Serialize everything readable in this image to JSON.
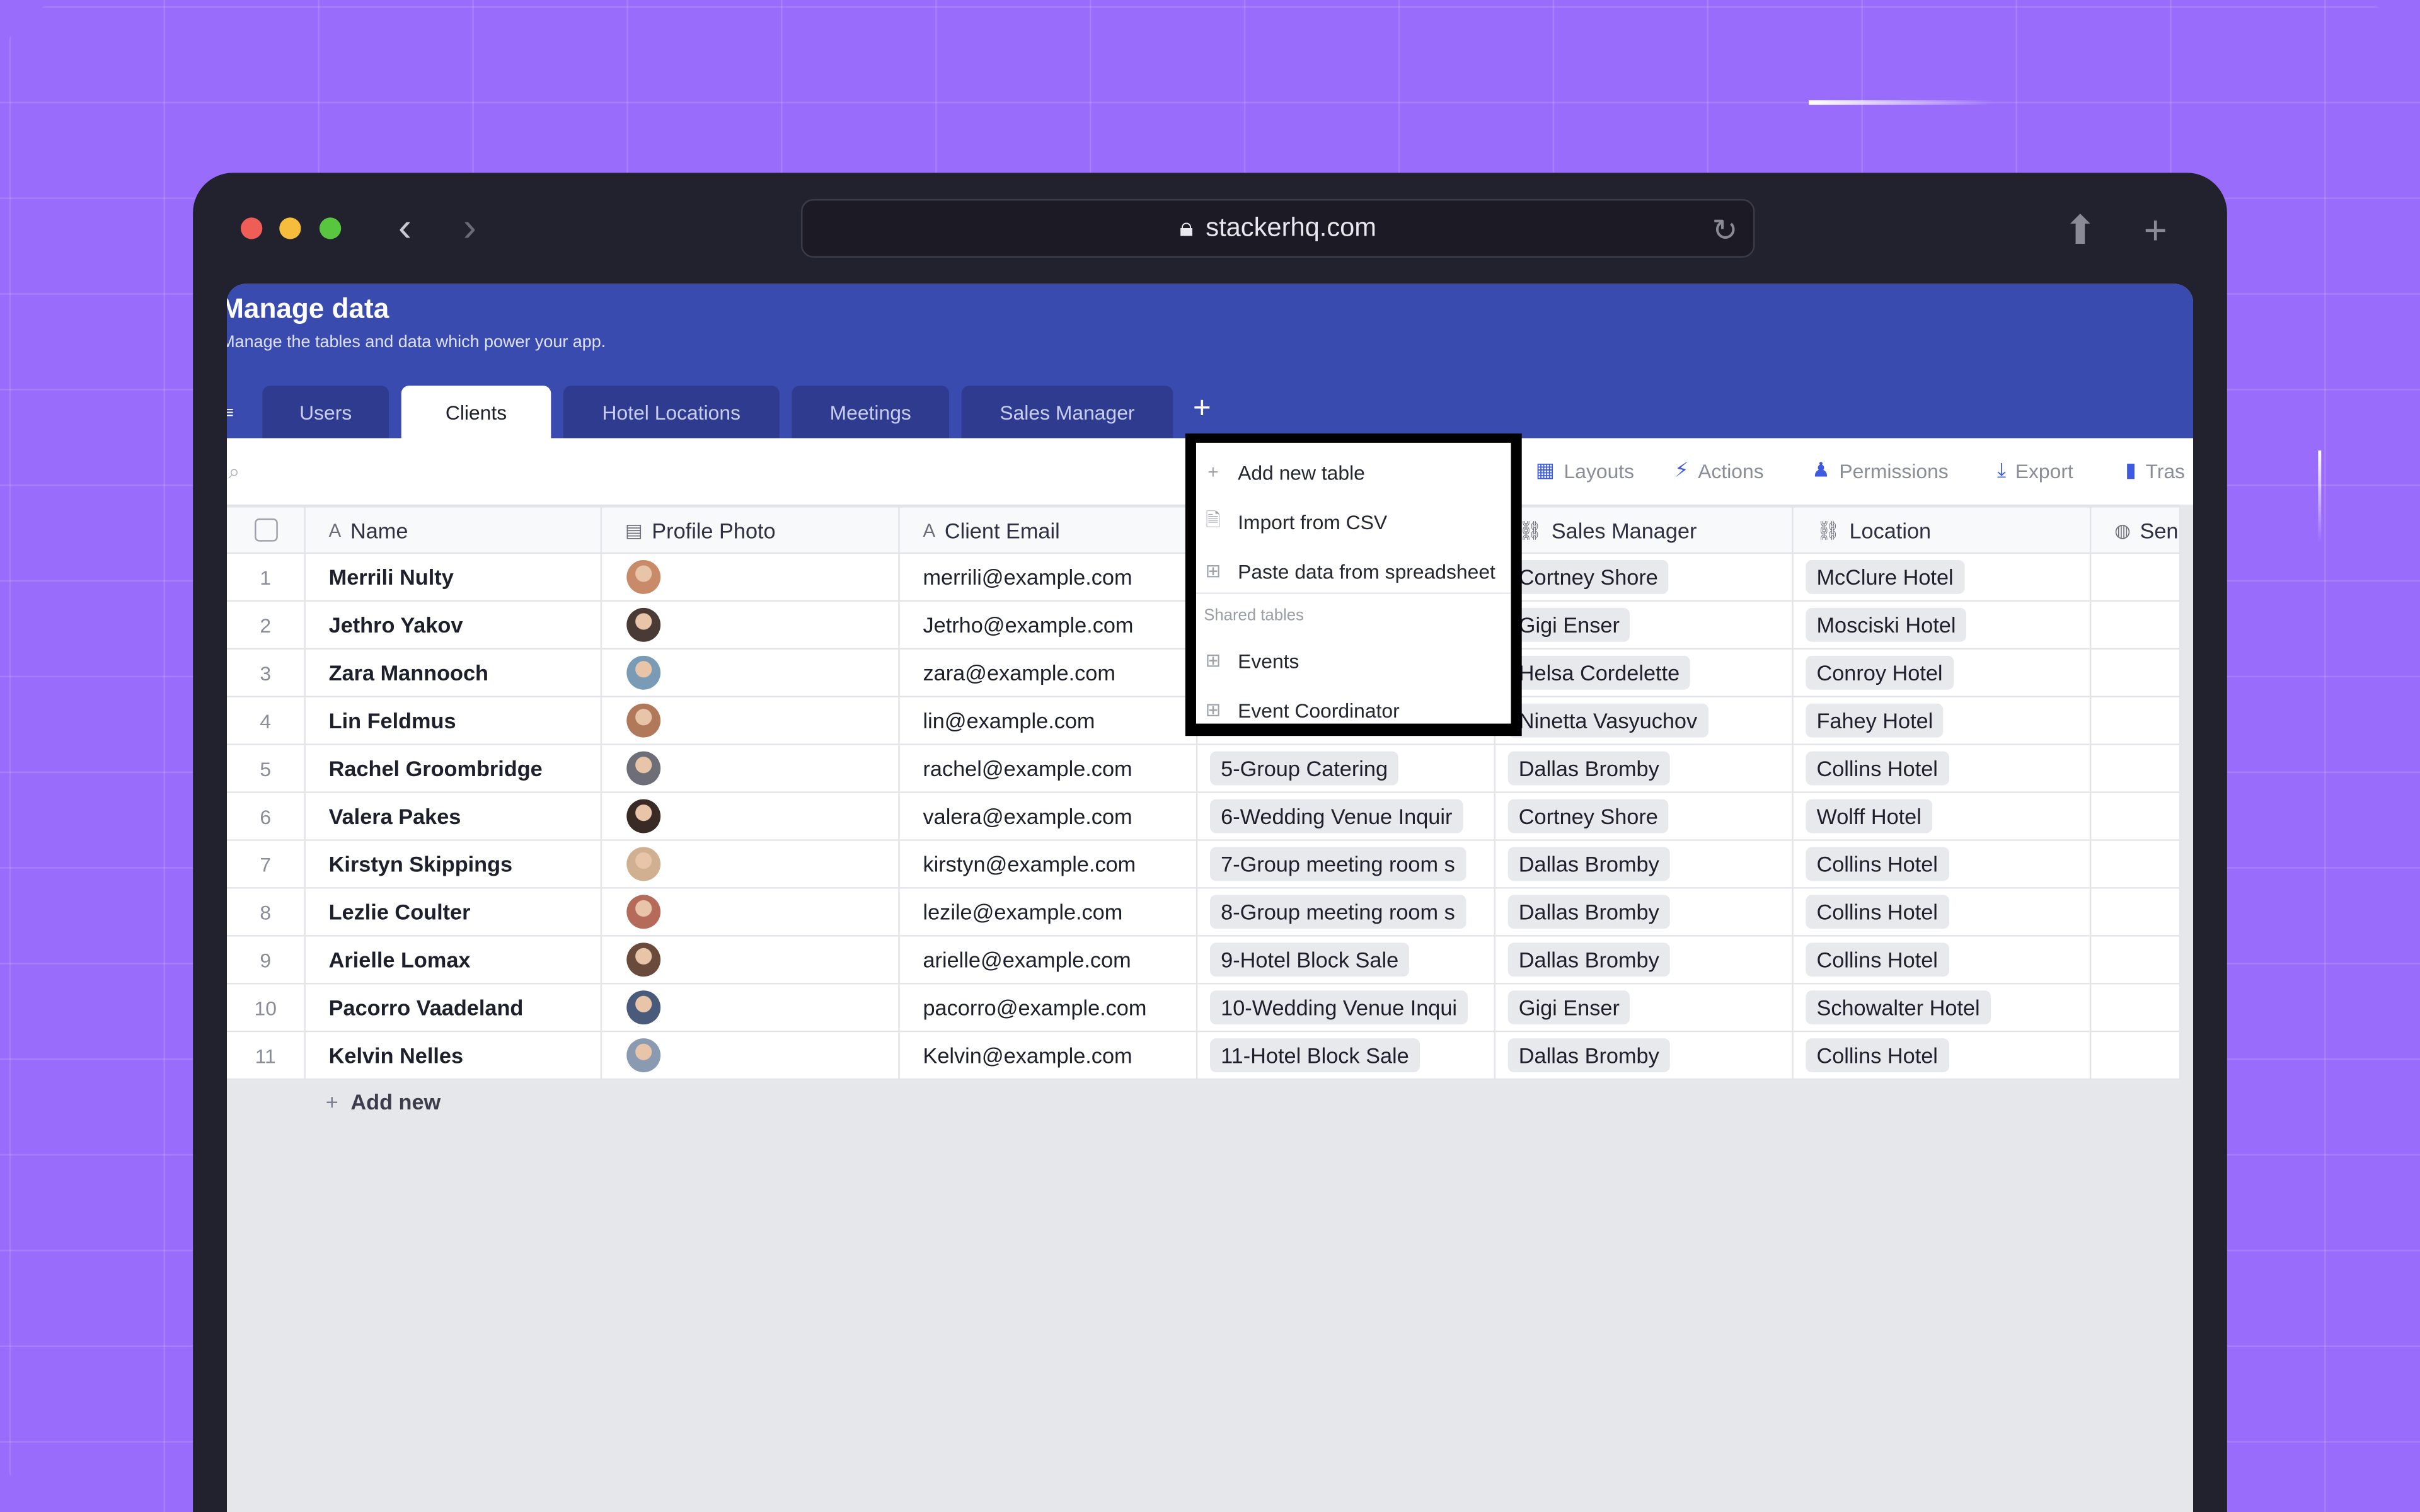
{
  "browser": {
    "url": "stackerhq.com"
  },
  "header": {
    "title": "Manage data",
    "subtitle": "Manage the tables and data which power your app."
  },
  "tabs": [
    {
      "label": "Users"
    },
    {
      "label": "Clients"
    },
    {
      "label": "Hotel Locations"
    },
    {
      "label": "Meetings"
    },
    {
      "label": "Sales Manager"
    }
  ],
  "active_tab": "Clients",
  "toolbar": {
    "layouts": "Layouts",
    "actions": "Actions",
    "permissions": "Permissions",
    "export": "Export",
    "trash": "Tras"
  },
  "menu": {
    "add_new_table": "Add new table",
    "import_csv": "Import from CSV",
    "paste_data": "Paste data from spreadsheet",
    "shared_label": "Shared tables",
    "shared": [
      "Events",
      "Event Coordinator"
    ]
  },
  "columns": [
    "Name",
    "Profile Photo",
    "Client Email",
    "",
    "Sales Manager",
    "Location",
    "Sen"
  ],
  "rows": [
    {
      "n": "1",
      "name": "Merrili Nulty",
      "email": "merrili@example.com",
      "meeting": "",
      "manager": "Cortney Shore",
      "location": "McClure Hotel"
    },
    {
      "n": "2",
      "name": "Jethro Yakov",
      "email": "Jetrho@example.com",
      "meeting": "",
      "manager": "Gigi Enser",
      "location": "Mosciski Hotel"
    },
    {
      "n": "3",
      "name": "Zara Mannooch",
      "email": "zara@example.com",
      "meeting": "",
      "manager": "Helsa Cordelette",
      "location": "Conroy Hotel"
    },
    {
      "n": "4",
      "name": "Lin Feldmus",
      "email": "lin@example.com",
      "meeting": "",
      "manager": "Ninetta Vasyuchov",
      "location": "Fahey Hotel"
    },
    {
      "n": "5",
      "name": "Rachel Groombridge",
      "email": "rachel@example.com",
      "meeting": "5-Group Catering",
      "manager": "Dallas Bromby",
      "location": "Collins Hotel"
    },
    {
      "n": "6",
      "name": "Valera Pakes",
      "email": "valera@example.com",
      "meeting": "6-Wedding Venue Inquir",
      "manager": "Cortney Shore",
      "location": "Wolff Hotel"
    },
    {
      "n": "7",
      "name": "Kirstyn Skippings",
      "email": "kirstyn@example.com",
      "meeting": "7-Group meeting room s",
      "manager": "Dallas Bromby",
      "location": "Collins Hotel"
    },
    {
      "n": "8",
      "name": "Lezlie Coulter",
      "email": "lezile@example.com",
      "meeting": "8-Group meeting room s",
      "manager": "Dallas Bromby",
      "location": "Collins Hotel"
    },
    {
      "n": "9",
      "name": "Arielle Lomax",
      "email": "arielle@example.com",
      "meeting": "9-Hotel Block Sale",
      "manager": "Dallas Bromby",
      "location": "Collins Hotel"
    },
    {
      "n": "10",
      "name": "Pacorro Vaadeland",
      "email": "pacorro@example.com",
      "meeting": "10-Wedding Venue Inqui",
      "manager": "Gigi Enser",
      "location": "Schowalter Hotel"
    },
    {
      "n": "11",
      "name": "Kelvin Nelles",
      "email": "Kelvin@example.com",
      "meeting": "11-Hotel Block Sale",
      "manager": "Dallas Bromby",
      "location": "Collins Hotel"
    }
  ],
  "add_new": "Add new",
  "colors": {
    "header": "#3a4bb0",
    "accent": "#3d5ae0",
    "background": "#9a6cfb"
  }
}
